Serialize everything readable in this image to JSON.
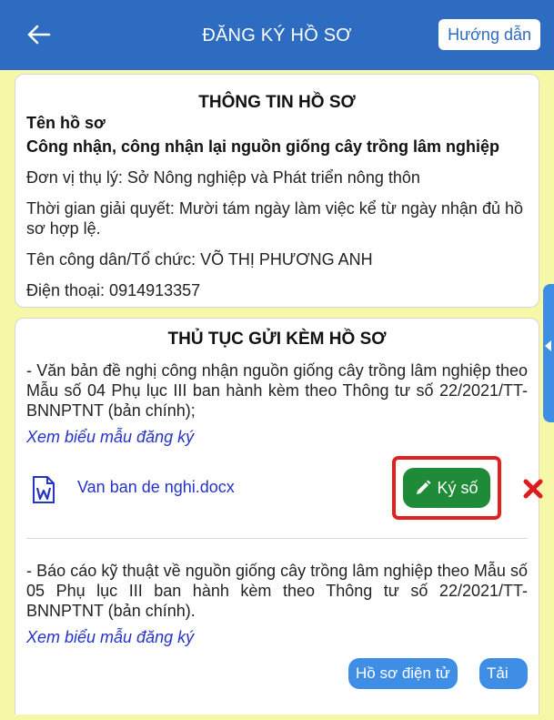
{
  "header": {
    "title": "ĐĂNG KÝ HỒ SƠ",
    "guide_label": "Hướng dẫn",
    "back_icon": "arrow-left-icon",
    "bg_color": "#2d6cc0"
  },
  "info": {
    "section_title": "THÔNG TIN HỒ SƠ",
    "name_label": "Tên hồ sơ",
    "name_value": "Công nhận, công nhận lại nguồn giống cây trồng lâm nghiệp",
    "unit": "Đơn vị thụ lý: Sở Nông nghiệp và Phát triển nông thôn",
    "duration": "Thời gian giải quyết: Mười tám ngày làm việc kể từ ngày nhận đủ hồ sơ hợp lệ.",
    "citizen": "Tên công dân/Tổ chức: VÕ THỊ PHƯƠNG ANH",
    "phone": "Điện thoại: 0914913357"
  },
  "attachments": {
    "section_title": "THỦ TỤC GỬI KÈM HỒ SƠ",
    "items": [
      {
        "description": "- Văn bản đề nghị công nhận nguồn giống cây trồng lâm nghiệp theo Mẫu số 04 Phụ lục III ban hành kèm theo Thông tư số 22/2021/TT-BNNPTNT (bản chính);",
        "sample_link": "Xem biểu mẫu đăng ký",
        "file_name": "Van ban de nghi.docx",
        "sign_label": "Ký số"
      },
      {
        "description": "- Báo cáo kỹ thuật về nguồn giống cây trồng lâm nghiệp theo Mẫu số 05 Phụ lục III ban hành kèm theo Thông tư số 22/2021/TT-BNNPTNT (bản chính).",
        "sample_link": "Xem biểu mẫu đăng ký",
        "electronic_label": "Hồ sơ điện tử",
        "upload_label": "Tải lên"
      }
    ]
  },
  "colors": {
    "page_bg": "#f7f7a8",
    "link": "#2533c7",
    "sign_button": "#1f8a37",
    "highlight": "#e32020",
    "pill": "#3f8ee6"
  }
}
